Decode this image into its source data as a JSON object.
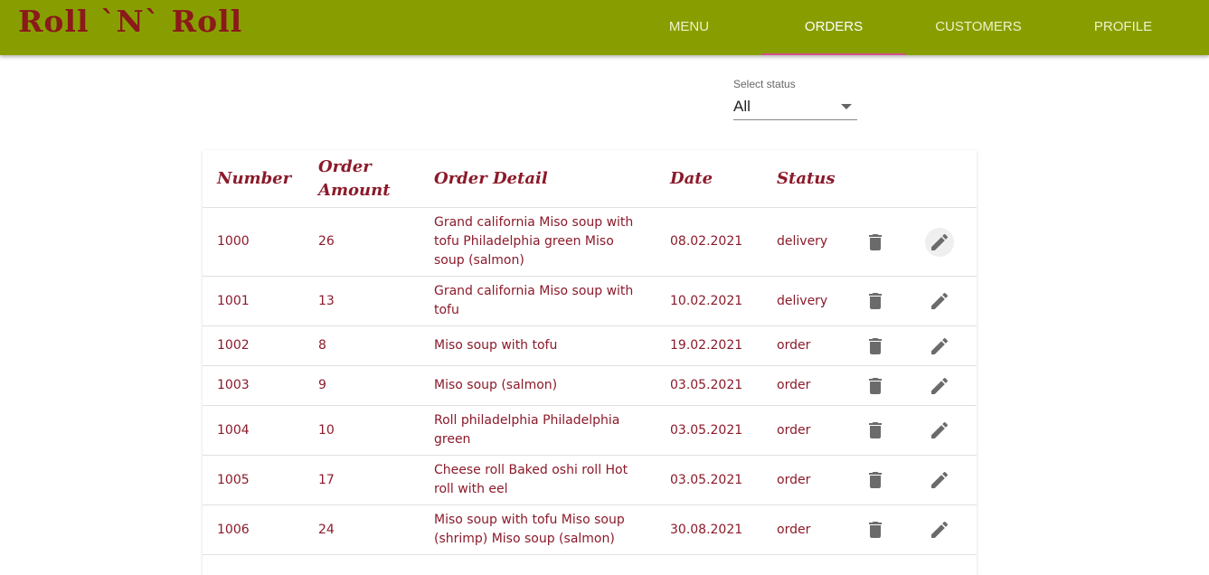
{
  "app": {
    "title": "Roll `N` Roll"
  },
  "nav": {
    "tabs": [
      {
        "label": "MENU"
      },
      {
        "label": "ORDERS"
      },
      {
        "label": "CUSTOMERS"
      },
      {
        "label": "PROFILE"
      }
    ],
    "active": "ORDERS"
  },
  "filter": {
    "label": "Select status",
    "value": "All"
  },
  "table": {
    "headers": {
      "number": "Number",
      "amount": "Order Amount",
      "detail": "Order Detail",
      "date": "Date",
      "status": "Status"
    },
    "rows": [
      {
        "number": "1000",
        "amount": "26",
        "detail": "Grand california Miso soup with tofu Philadelphia green Miso soup (salmon)",
        "date": "08.02.2021",
        "status": "delivery"
      },
      {
        "number": "1001",
        "amount": "13",
        "detail": "Grand california Miso soup with tofu",
        "date": "10.02.2021",
        "status": "delivery"
      },
      {
        "number": "1002",
        "amount": "8",
        "detail": "Miso soup with tofu",
        "date": "19.02.2021",
        "status": "order"
      },
      {
        "number": "1003",
        "amount": "9",
        "detail": "Miso soup (salmon)",
        "date": "03.05.2021",
        "status": "order"
      },
      {
        "number": "1004",
        "amount": "10",
        "detail": "Roll philadelphia Philadelphia green",
        "date": "03.05.2021",
        "status": "order"
      },
      {
        "number": "1005",
        "amount": "17",
        "detail": "Cheese roll Baked oshi roll Hot roll with eel",
        "date": "03.05.2021",
        "status": "order"
      },
      {
        "number": "1006",
        "amount": "24",
        "detail": "Miso soup with tofu Miso soup (shrimp) Miso soup (salmon)",
        "date": "30.08.2021",
        "status": "order"
      }
    ]
  },
  "icons": {
    "delete": "delete-icon",
    "edit": "edit-icon"
  },
  "colors": {
    "appbar": "#889e00",
    "brand_text": "#8b1a1a",
    "active_indicator": "#d54f8a",
    "table_text": "#8b1a2a"
  }
}
